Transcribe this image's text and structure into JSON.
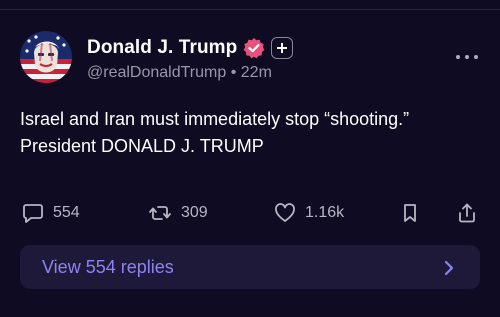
{
  "author": {
    "display_name": "Donald J. Trump",
    "handle": "@realDonaldTrump",
    "separator": "•",
    "time_ago": "22m",
    "verified_color": "#e8527a"
  },
  "post": {
    "lines": [
      "Israel and Iran must immediately stop “shooting.”",
      "President DONALD J. TRUMP"
    ]
  },
  "actions": {
    "replies": "554",
    "reposts": "309",
    "likes": "1.16k"
  },
  "replies_bar": {
    "label": "View 554 replies",
    "accent": "#8b84f0"
  },
  "icons": {
    "follow": "plus-icon",
    "more": "more-dots-icon",
    "reply": "reply-icon",
    "repost": "repost-icon",
    "like": "heart-icon",
    "bookmark": "bookmark-icon",
    "share": "share-icon",
    "chevron": "chevron-right-icon"
  }
}
